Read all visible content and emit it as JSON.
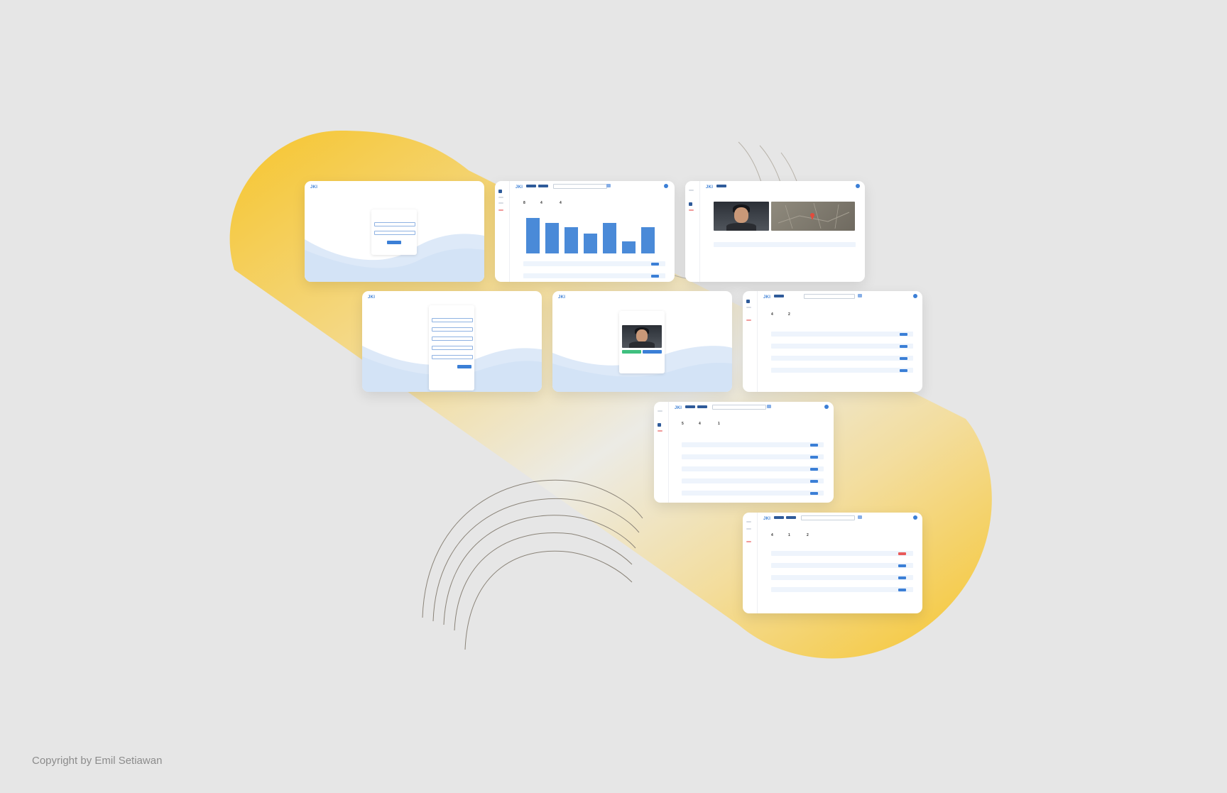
{
  "footer": {
    "copyright": "Copyright by Emil Setiawan"
  },
  "brand": {
    "logo": "JKI"
  },
  "colors": {
    "background": "#e6e6e6",
    "accent": "#3b7fd6",
    "navy": "#2f5b9a",
    "yellow": "#f5c42c"
  },
  "dashboard": {
    "stats": [
      "8",
      "4",
      "4"
    ],
    "bars": [
      60,
      52,
      44,
      34,
      52,
      20,
      44
    ]
  },
  "checks": {
    "stats": [
      "4",
      "2"
    ]
  },
  "attendance": {
    "stats": [
      "5",
      "4",
      "1"
    ]
  },
  "users": {
    "stats": [
      "4",
      "1",
      "2"
    ]
  },
  "icons": [
    "search-icon",
    "avatar-icon",
    "map-pin-icon"
  ]
}
